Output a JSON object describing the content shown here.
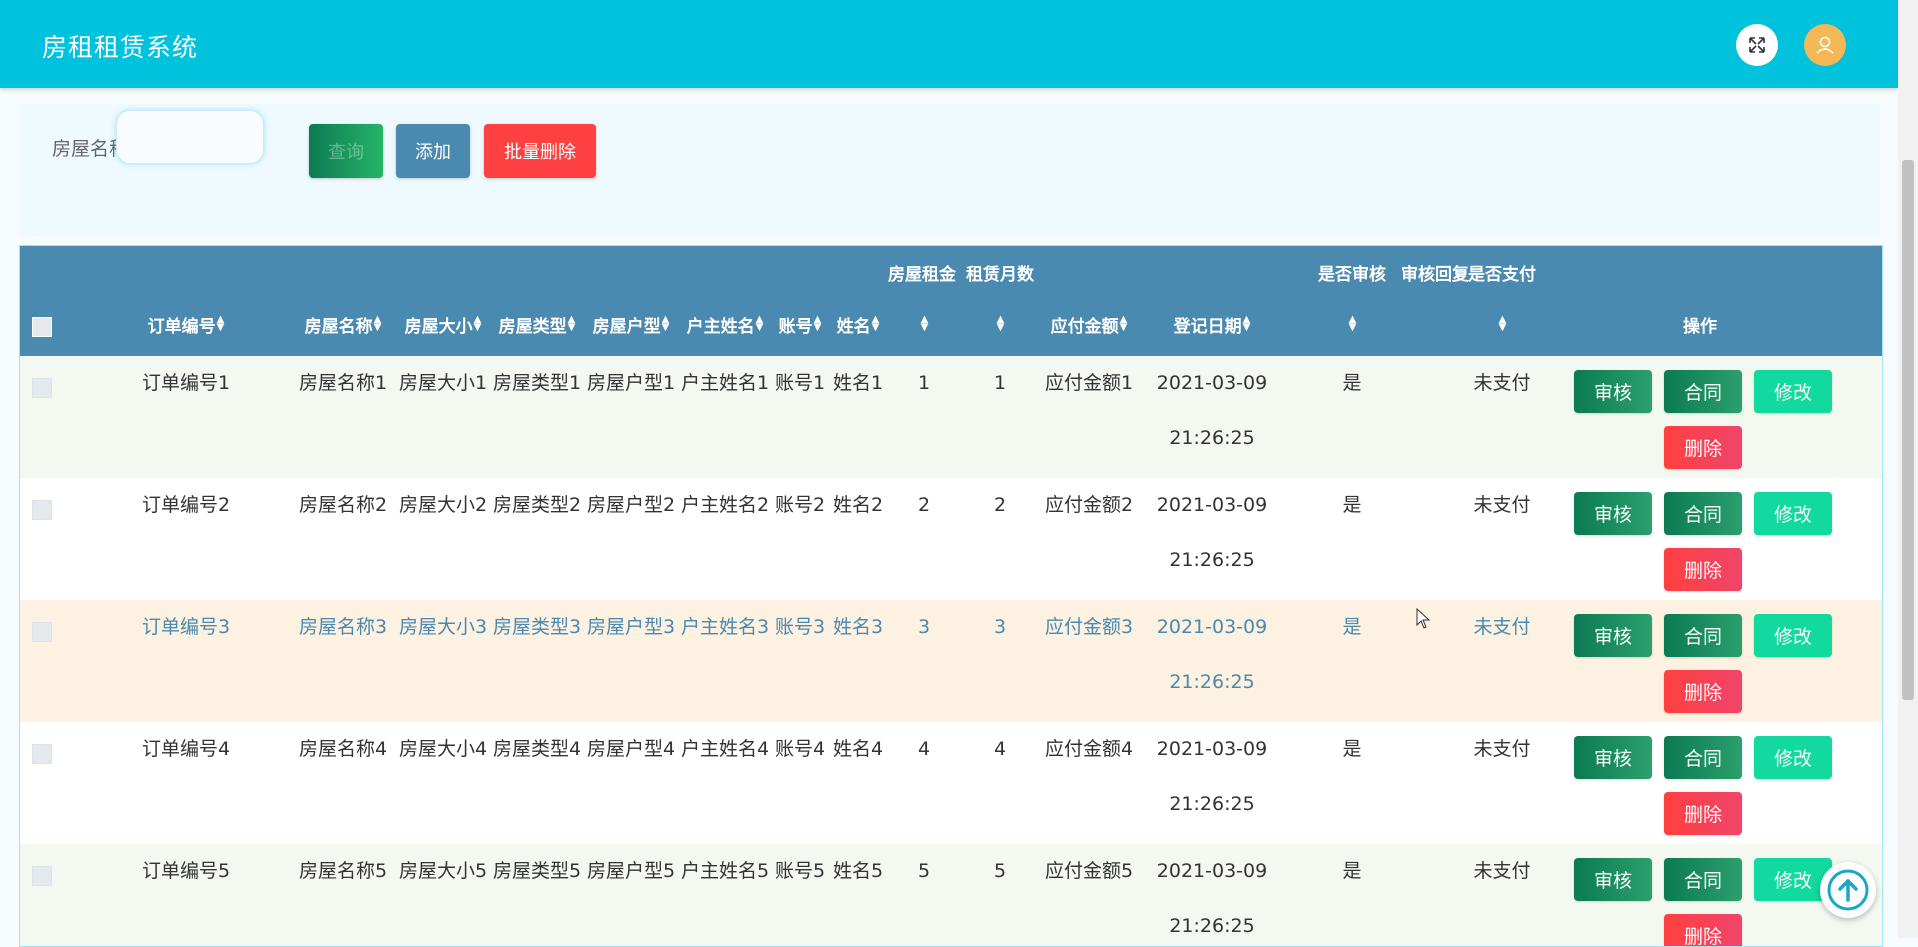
{
  "header": {
    "title": "房租租赁系统"
  },
  "search": {
    "label": "房屋名称",
    "placeholder": "",
    "value": "",
    "query_label": "查询",
    "add_label": "添加",
    "batch_delete_label": "批量删除"
  },
  "table": {
    "headers": {
      "order_no": "订单编号",
      "house_name": "房屋名称",
      "house_size": "房屋大小",
      "house_type": "房屋类型",
      "house_layout": "房屋户型",
      "owner_name": "户主姓名",
      "account": "账号",
      "name": "姓名",
      "rent": "房屋租金",
      "months": "租赁月数",
      "amount": "应付金额",
      "reg_date": "登记日期",
      "audited": "是否审核",
      "audit_reply": "审核回复",
      "paid": "是否支付",
      "ops": "操作"
    },
    "rows": [
      {
        "order_no": "订单编号1",
        "house_name": "房屋名称1",
        "house_size": "房屋大小1",
        "house_type": "房屋类型1",
        "house_layout": "房屋户型1",
        "owner_name": "户主姓名1",
        "account": "账号1",
        "name": "姓名1",
        "rent": "1",
        "months": "1",
        "amount": "应付金额1",
        "reg_date": "2021-03-09 21:26:25",
        "audited": "是",
        "audit_reply": "",
        "paid": "未支付"
      },
      {
        "order_no": "订单编号2",
        "house_name": "房屋名称2",
        "house_size": "房屋大小2",
        "house_type": "房屋类型2",
        "house_layout": "房屋户型2",
        "owner_name": "户主姓名2",
        "account": "账号2",
        "name": "姓名2",
        "rent": "2",
        "months": "2",
        "amount": "应付金额2",
        "reg_date": "2021-03-09 21:26:25",
        "audited": "是",
        "audit_reply": "",
        "paid": "未支付"
      },
      {
        "order_no": "订单编号3",
        "house_name": "房屋名称3",
        "house_size": "房屋大小3",
        "house_type": "房屋类型3",
        "house_layout": "房屋户型3",
        "owner_name": "户主姓名3",
        "account": "账号3",
        "name": "姓名3",
        "rent": "3",
        "months": "3",
        "amount": "应付金额3",
        "reg_date": "2021-03-09 21:26:25",
        "audited": "是",
        "audit_reply": "",
        "paid": "未支付"
      },
      {
        "order_no": "订单编号4",
        "house_name": "房屋名称4",
        "house_size": "房屋大小4",
        "house_type": "房屋类型4",
        "house_layout": "房屋户型4",
        "owner_name": "户主姓名4",
        "account": "账号4",
        "name": "姓名4",
        "rent": "4",
        "months": "4",
        "amount": "应付金额4",
        "reg_date": "2021-03-09 21:26:25",
        "audited": "是",
        "audit_reply": "",
        "paid": "未支付"
      },
      {
        "order_no": "订单编号5",
        "house_name": "房屋名称5",
        "house_size": "房屋大小5",
        "house_type": "房屋类型5",
        "house_layout": "房屋户型5",
        "owner_name": "户主姓名5",
        "account": "账号5",
        "name": "姓名5",
        "rent": "5",
        "months": "5",
        "amount": "应付金额5",
        "reg_date": "2021-03-09 21:26:25",
        "audited": "是",
        "audit_reply": "",
        "paid": "未支付"
      }
    ],
    "actions": {
      "audit": "审核",
      "contract": "合同",
      "edit": "修改",
      "delete": "删除"
    }
  },
  "colors": {
    "header": "#00c2dc",
    "table_head": "#4a89b0",
    "delete": "#ff4040",
    "edit": "#12d99e",
    "audit": "#0c7a52"
  },
  "icons": {
    "fullscreen": "fullscreen-icon",
    "user": "user-icon",
    "back_to_top": "arrow-up-icon"
  }
}
